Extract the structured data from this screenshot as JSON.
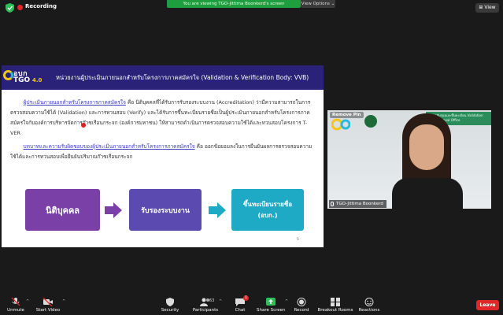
{
  "topbar": {
    "recording_label": "Recording",
    "banner_text": "You are viewing TGO-Jittima Boonkerd's screen",
    "view_options_label": "View Options ⌄",
    "view_label": "View"
  },
  "slide": {
    "logo_top": "อบก",
    "logo_bottom": "TGO",
    "logo_version": "4.0",
    "title": "หน่วยงานผู้ประเมินภายนอกสำหรับโครงการภาคสมัครใจ (Validation & Verification Body: VVB)",
    "para1_highlight": "ผู้ประเมินภายนอกสำหรับโครงการภาคสมัครใจ",
    "para1_text": " คือ นิติบุคคลที่ได้รับการรับรองระบบงาน (Accreditation) ว่ามีความสามารถในการตรวจสอบความใช้ได้ (Validation) และการทวนสอบ (Verify) และได้รับการขึ้นทะเบียนรายชื่อเป็นผู้ประเมินภายนอกสำหรับโครงการภาคสมัครใจกับองค์การบริหารจัดการก๊าซเรือนกระจก (องค์การมหาชน) ให้สามารถดำเนินการตรวจสอบความใช้ได้และทวนสอบโครงการ T-VER",
    "para2_highlight": "บทบาทและความรับผิดชอบของผู้ประเมินภายนอกสำหรับโครงการภาคสมัครใจ",
    "para2_text": " คือ ออกข้อยอมลงในการยืนยันผลการตรวจสอบความใช้ได้และการทวนสอบเพื่อยืนยันปริมาณก๊าซเรือนกระจก",
    "box1": "นิติบุคคล",
    "box2": "รับรองระบบงาน",
    "box3_line1": "ขึ้นทะเบียนรายชื่อ",
    "box3_line2": "(อบก.)",
    "page_number": "5"
  },
  "video": {
    "remove_pin_label": "Remove Pin",
    "sign_text": "สำนักรับรองและขึ้นทะเบียน Validation and Approval Office",
    "participant_name": "TGO-Jittima Boonkerd"
  },
  "toolbar": {
    "unmute": "Unmute",
    "start_video": "Start Video",
    "security": "Security",
    "participants": "Participants",
    "participants_count": "63",
    "chat": "Chat",
    "chat_badge": "1",
    "share_screen": "Share Screen",
    "record": "Record",
    "breakout_rooms": "Breakout Rooms",
    "reactions": "Reactions",
    "leave": "Leave"
  },
  "colors": {
    "slide_header": "#2a2278",
    "box1": "#7b3fa8",
    "box2": "#5b4bb0",
    "box3": "#1ea9c4",
    "banner": "#1e9e3e",
    "leave": "#e02828"
  }
}
